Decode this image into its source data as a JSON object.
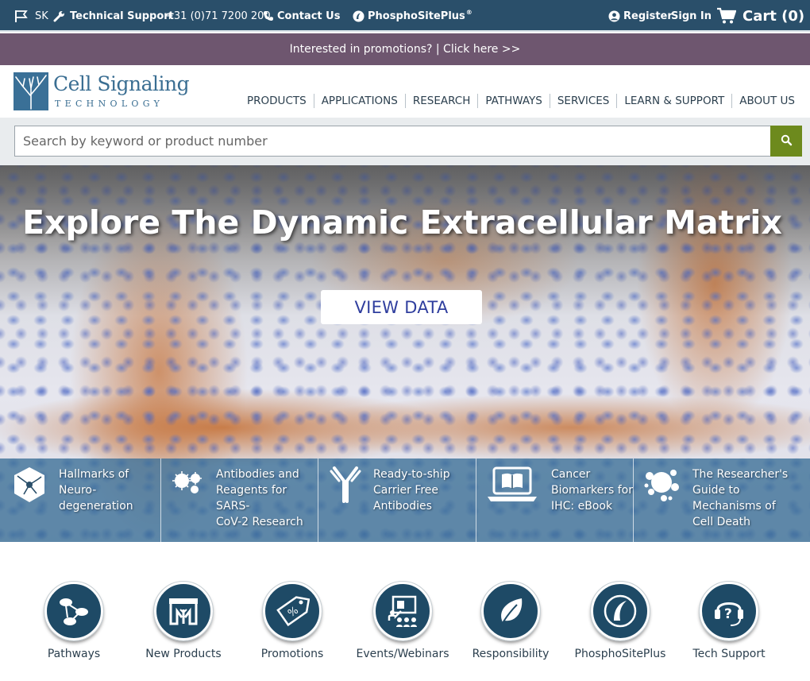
{
  "topbar": {
    "country_code": "SK",
    "technical_support": "Technical Support",
    "phone": "+31 (0)71 7200 200",
    "contact_us": "Contact Us",
    "phosphositeplus": "PhosphoSitePlus",
    "phosphositeplus_mark": "®",
    "register": "Register",
    "sign_in": "Sign In",
    "cart": "Cart (0)"
  },
  "promo": {
    "text": "Interested in promotions? | Click here >>"
  },
  "logo": {
    "line1": "Cell Signaling",
    "line2": "TECHNOLOGY"
  },
  "nav": {
    "items": [
      "PRODUCTS",
      "APPLICATIONS",
      "RESEARCH",
      "PATHWAYS",
      "SERVICES",
      "LEARN & SUPPORT",
      "ABOUT US"
    ]
  },
  "search": {
    "placeholder": "Search by keyword or product number",
    "value": ""
  },
  "hero": {
    "title": "Explore The Dynamic Extracellular Matrix",
    "button": "VIEW DATA"
  },
  "features": [
    {
      "icon": "neuron-icon",
      "lines": [
        "Hallmarks of",
        "Neuro-",
        "degeneration"
      ]
    },
    {
      "icon": "virus-icon",
      "lines": [
        "Antibodies and",
        "Reagents for SARS-",
        "CoV-2 Research"
      ]
    },
    {
      "icon": "antibody-icon",
      "lines": [
        "Ready-to-ship",
        "Carrier Free",
        "Antibodies"
      ]
    },
    {
      "icon": "laptop-book-icon",
      "lines": [
        "Cancer",
        "Biomarkers for",
        "IHC: eBook"
      ]
    },
    {
      "icon": "cell-death-icon",
      "lines": [
        "The Researcher's",
        "Guide to",
        "Mechanisms of",
        "Cell Death"
      ]
    }
  ],
  "quick_links": [
    {
      "label": "Pathways",
      "icon": "pathways-icon"
    },
    {
      "label": "New Products",
      "icon": "new-products-icon"
    },
    {
      "label": "Promotions",
      "icon": "promotions-tag-icon"
    },
    {
      "label": "Events/Webinars",
      "icon": "webinar-icon"
    },
    {
      "label": "Responsibility",
      "icon": "leaf-icon"
    },
    {
      "label": "PhosphoSitePlus",
      "icon": "phosphositeplus-icon"
    },
    {
      "label": "Tech Support",
      "icon": "headset-icon"
    }
  ],
  "colors": {
    "topbar": "#2a4f6a",
    "promo": "#6e566f",
    "search_button": "#6d8a1d",
    "brand_blue": "#3a6e92",
    "quick_circle": "#1e4a66"
  }
}
